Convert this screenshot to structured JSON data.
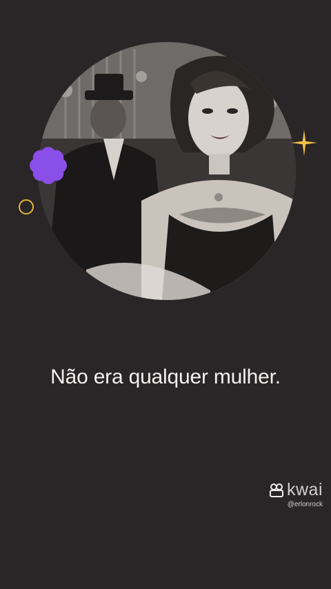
{
  "caption": {
    "text": "Não era qualquer mulher."
  },
  "watermark": {
    "brand": "kwai",
    "handle": "@erlonrock",
    "icon": "kwai-logo-icon"
  },
  "decorations": {
    "flower_color": "#8a4fe8",
    "ring_color": "#e7b53d",
    "sparkle_color": "#f1c14a"
  },
  "background_color": "#2a2526"
}
